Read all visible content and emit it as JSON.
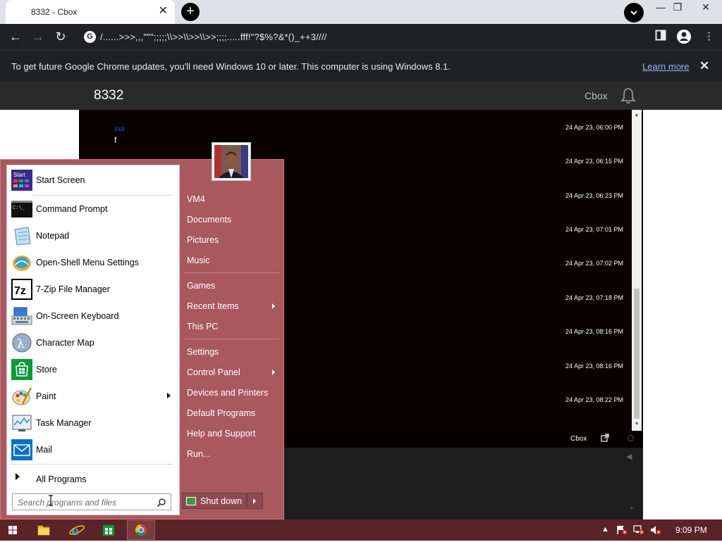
{
  "browser": {
    "tab_title": "8332 - Cbox",
    "tab_close": "✕",
    "new_tab": "+",
    "url": "/......>>>,,,\"\"\";;;;;\\\\>>\\\\>>\\\\>>;;;;.....fff!\"?$%?&*()_++3////",
    "window_controls": [
      "—",
      "❐",
      "✕"
    ]
  },
  "infobar": {
    "message": "To get future Google Chrome updates, you'll need Windows 10 or later. This computer is using Windows 8.1.",
    "link": "Learn more",
    "close": "✕"
  },
  "page": {
    "title": "8332",
    "brand": "Cbox"
  },
  "chat": {
    "first_user": "sss",
    "first_text": "f",
    "timestamps": [
      "24 Apr 23, 06:00 PM",
      "24 Apr 23, 06:15 PM",
      "24 Apr 23, 06:23 PM",
      "24 Apr 23, 07:01 PM",
      "24 Apr 23, 07:02 PM",
      "24 Apr 23, 07:18 PM",
      "24 Apr 23, 08:16 PM",
      "24 Apr 23, 08:16 PM",
      "24 Apr 23, 08:22 PM"
    ],
    "footer_brand": "Cbox"
  },
  "start_menu": {
    "pinned": [
      {
        "label": "Start Screen",
        "icon": "start-screen-icon"
      },
      {
        "label": "Command Prompt",
        "icon": "command-prompt-icon"
      },
      {
        "label": "Notepad",
        "icon": "notepad-icon"
      },
      {
        "label": "Open-Shell Menu Settings",
        "icon": "open-shell-icon"
      },
      {
        "label": "7-Zip File Manager",
        "icon": "seven-zip-icon"
      },
      {
        "label": "On-Screen Keyboard",
        "icon": "keyboard-icon"
      },
      {
        "label": "Character Map",
        "icon": "character-map-icon"
      },
      {
        "label": "Store",
        "icon": "store-icon"
      },
      {
        "label": "Paint",
        "icon": "paint-icon"
      },
      {
        "label": "Task Manager",
        "icon": "task-manager-icon"
      },
      {
        "label": "Mail",
        "icon": "mail-icon"
      }
    ],
    "all_programs": "All Programs",
    "search_placeholder": "Search programs and files",
    "right": [
      "VM4",
      "Documents",
      "Pictures",
      "Music",
      "Games",
      "Recent Items",
      "This PC",
      "Settings",
      "Control Panel",
      "Devices and Printers",
      "Default Programs",
      "Help and Support",
      "Run..."
    ],
    "shutdown": "Shut down"
  },
  "taskbar": {
    "clock": "9:09 PM"
  },
  "colors": {
    "start_menu_bg": "#a9585e",
    "taskbar_bg": "#5a2328",
    "chat_bg": "#0a0000",
    "link_blue": "#8ab4f8"
  }
}
